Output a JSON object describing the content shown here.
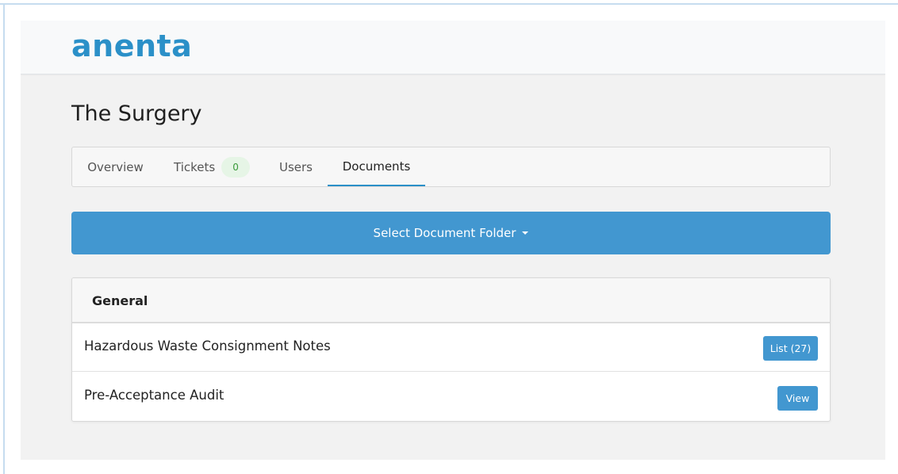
{
  "app": {
    "logo_text": "anenta",
    "brand_color": "#2b90c8",
    "accent_color": "#4297d0"
  },
  "page": {
    "title": "The Surgery"
  },
  "tabs": [
    {
      "label": "Overview",
      "active": false
    },
    {
      "label": "Tickets",
      "badge": "0",
      "active": false
    },
    {
      "label": "Users",
      "active": false
    },
    {
      "label": "Documents",
      "active": true
    }
  ],
  "folder_select": {
    "label": "Select Document Folder",
    "icon": "caret-down-icon"
  },
  "folder": {
    "name": "General",
    "documents": [
      {
        "name": "Hazardous Waste Consignment Notes",
        "action_label": "List (27)"
      },
      {
        "name": "Pre-Acceptance Audit",
        "action_label": "View"
      }
    ]
  }
}
